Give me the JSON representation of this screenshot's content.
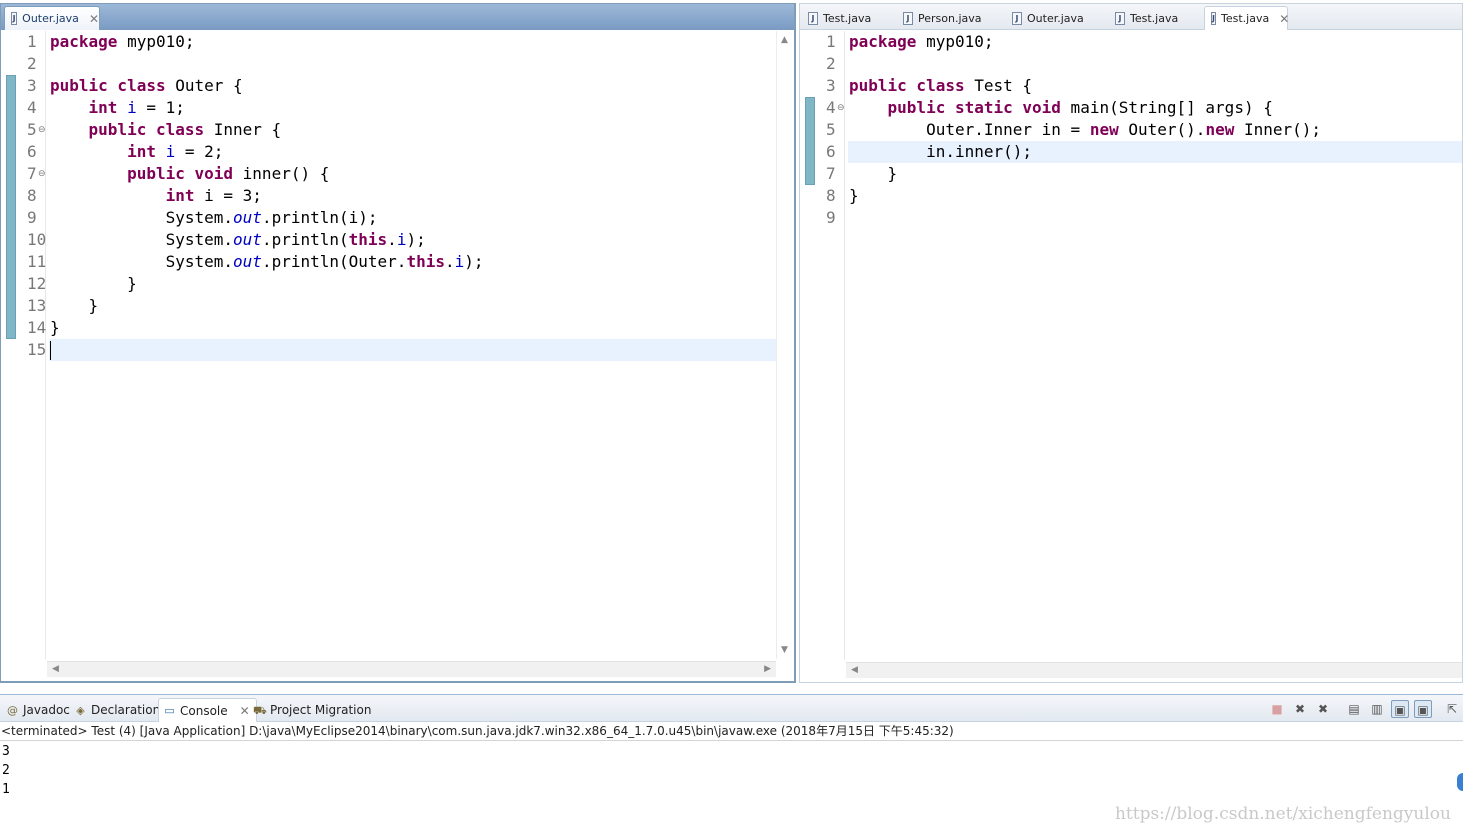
{
  "left_editor": {
    "tab_label": "Outer.java",
    "lines": [
      {
        "n": "1",
        "segs": [
          {
            "k": "kw",
            "t": "package"
          },
          {
            "k": "",
            "t": " myp010;"
          }
        ]
      },
      {
        "n": "2",
        "segs": []
      },
      {
        "n": "3",
        "segs": [
          {
            "k": "kw",
            "t": "public class"
          },
          {
            "k": "",
            "t": " Outer {"
          }
        ]
      },
      {
        "n": "4",
        "segs": [
          {
            "k": "",
            "t": "    "
          },
          {
            "k": "kw",
            "t": "int"
          },
          {
            "k": "",
            "t": " "
          },
          {
            "k": "fld",
            "t": "i"
          },
          {
            "k": "",
            "t": " = 1;"
          }
        ]
      },
      {
        "n": "5",
        "fold": true,
        "segs": [
          {
            "k": "",
            "t": "    "
          },
          {
            "k": "kw",
            "t": "public class"
          },
          {
            "k": "",
            "t": " Inner {"
          }
        ]
      },
      {
        "n": "6",
        "segs": [
          {
            "k": "",
            "t": "        "
          },
          {
            "k": "kw",
            "t": "int"
          },
          {
            "k": "",
            "t": " "
          },
          {
            "k": "fld",
            "t": "i"
          },
          {
            "k": "",
            "t": " = 2;"
          }
        ]
      },
      {
        "n": "7",
        "fold": true,
        "segs": [
          {
            "k": "",
            "t": "        "
          },
          {
            "k": "kw",
            "t": "public void"
          },
          {
            "k": "",
            "t": " inner() {"
          }
        ]
      },
      {
        "n": "8",
        "segs": [
          {
            "k": "",
            "t": "            "
          },
          {
            "k": "kw",
            "t": "int"
          },
          {
            "k": "",
            "t": " i = 3;"
          }
        ]
      },
      {
        "n": "9",
        "segs": [
          {
            "k": "",
            "t": "            System."
          },
          {
            "k": "sfld",
            "t": "out"
          },
          {
            "k": "",
            "t": ".println(i);"
          }
        ]
      },
      {
        "n": "10",
        "segs": [
          {
            "k": "",
            "t": "            System."
          },
          {
            "k": "sfld",
            "t": "out"
          },
          {
            "k": "",
            "t": ".println("
          },
          {
            "k": "kw",
            "t": "this"
          },
          {
            "k": "",
            "t": "."
          },
          {
            "k": "fld",
            "t": "i"
          },
          {
            "k": "",
            "t": ");"
          }
        ]
      },
      {
        "n": "11",
        "segs": [
          {
            "k": "",
            "t": "            System."
          },
          {
            "k": "sfld",
            "t": "out"
          },
          {
            "k": "",
            "t": ".println(Outer."
          },
          {
            "k": "kw",
            "t": "this"
          },
          {
            "k": "",
            "t": "."
          },
          {
            "k": "fld",
            "t": "i"
          },
          {
            "k": "",
            "t": ");"
          }
        ]
      },
      {
        "n": "12",
        "segs": [
          {
            "k": "",
            "t": "        }"
          }
        ]
      },
      {
        "n": "13",
        "segs": [
          {
            "k": "",
            "t": "    }"
          }
        ]
      },
      {
        "n": "14",
        "segs": [
          {
            "k": "",
            "t": "}"
          }
        ]
      },
      {
        "n": "15",
        "highlight": true,
        "caret": true,
        "segs": []
      }
    ]
  },
  "right_editor": {
    "tabs": [
      "Test.java",
      "Person.java",
      "Outer.java",
      "Test.java",
      "Test.java"
    ],
    "active_tab": 4,
    "lines": [
      {
        "n": "1",
        "segs": [
          {
            "k": "kw",
            "t": "package"
          },
          {
            "k": "",
            "t": " myp010;"
          }
        ]
      },
      {
        "n": "2",
        "segs": []
      },
      {
        "n": "3",
        "segs": [
          {
            "k": "kw",
            "t": "public class"
          },
          {
            "k": "",
            "t": " Test {"
          }
        ]
      },
      {
        "n": "4",
        "fold": true,
        "segs": [
          {
            "k": "",
            "t": "    "
          },
          {
            "k": "kw",
            "t": "public static void"
          },
          {
            "k": "",
            "t": " main(String[] args) {"
          }
        ]
      },
      {
        "n": "5",
        "segs": [
          {
            "k": "",
            "t": "        Outer.Inner in = "
          },
          {
            "k": "kw",
            "t": "new"
          },
          {
            "k": "",
            "t": " Outer()."
          },
          {
            "k": "kw",
            "t": "new"
          },
          {
            "k": "",
            "t": " Inner();"
          }
        ]
      },
      {
        "n": "6",
        "highlight": true,
        "segs": [
          {
            "k": "",
            "t": "        in.inner();"
          }
        ]
      },
      {
        "n": "7",
        "segs": [
          {
            "k": "",
            "t": "    }"
          }
        ]
      },
      {
        "n": "8",
        "segs": [
          {
            "k": "",
            "t": "}"
          }
        ]
      },
      {
        "n": "9",
        "segs": []
      }
    ]
  },
  "console": {
    "tabs": [
      {
        "label": "Javadoc",
        "icon": "at-icon"
      },
      {
        "label": "Declaration",
        "icon": "declaration-icon"
      },
      {
        "label": "Console",
        "icon": "console-icon",
        "active": true
      },
      {
        "label": "Project Migration",
        "icon": "migration-icon"
      }
    ],
    "status": "<terminated> Test (4) [Java Application] D:\\java\\MyEclipse2014\\binary\\com.sun.java.jdk7.win32.x86_64_1.7.0.u45\\bin\\javaw.exe (2018年7月15日 下午5:45:32)",
    "output": [
      "3",
      "2",
      "1"
    ]
  },
  "watermark": "https://blog.csdn.net/xichengfengyulou"
}
